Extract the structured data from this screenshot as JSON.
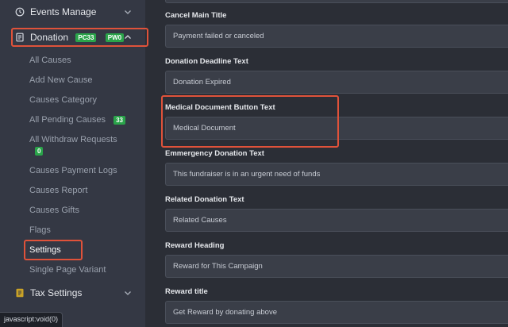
{
  "sidebar": {
    "events_manage": "Events Manage",
    "donation": {
      "label": "Donation",
      "badges": [
        "PC33",
        "PW0"
      ]
    },
    "items": [
      {
        "label": "All Causes"
      },
      {
        "label": "Add New Cause"
      },
      {
        "label": "Causes Category"
      },
      {
        "label": "All Pending Causes",
        "badge": "33"
      },
      {
        "label": "All Withdraw Requests",
        "badge": "0"
      },
      {
        "label": "Causes Payment Logs"
      },
      {
        "label": "Causes Report"
      },
      {
        "label": "Causes Gifts"
      },
      {
        "label": "Flags"
      },
      {
        "label": "Settings",
        "active": true
      },
      {
        "label": "Single Page Variant"
      }
    ],
    "tax_settings": "Tax Settings"
  },
  "fields": [
    {
      "label": "Cancel Main Title",
      "value": "Payment failed or canceled"
    },
    {
      "label": "Donation Deadline Text",
      "value": "Donation Expired"
    },
    {
      "label": "Medical Document Button Text",
      "value": "Medical Document"
    },
    {
      "label": "Emmergency Donation Text",
      "value": "This fundraiser is in an urgent need of funds"
    },
    {
      "label": "Related Donation Text",
      "value": "Related Causes"
    },
    {
      "label": "Reward Heading",
      "value": "Reward for This Campaign"
    },
    {
      "label": "Reward title",
      "value": "Get Reward by donating above"
    }
  ],
  "statusbar": {
    "text": "javascript:void(0)"
  },
  "colors": {
    "sidebar_bg": "#343844",
    "content_bg": "#2b2e36",
    "input_bg": "#3a3e48",
    "badge_green": "#2aa44a",
    "highlight_red": "#e0523a"
  }
}
